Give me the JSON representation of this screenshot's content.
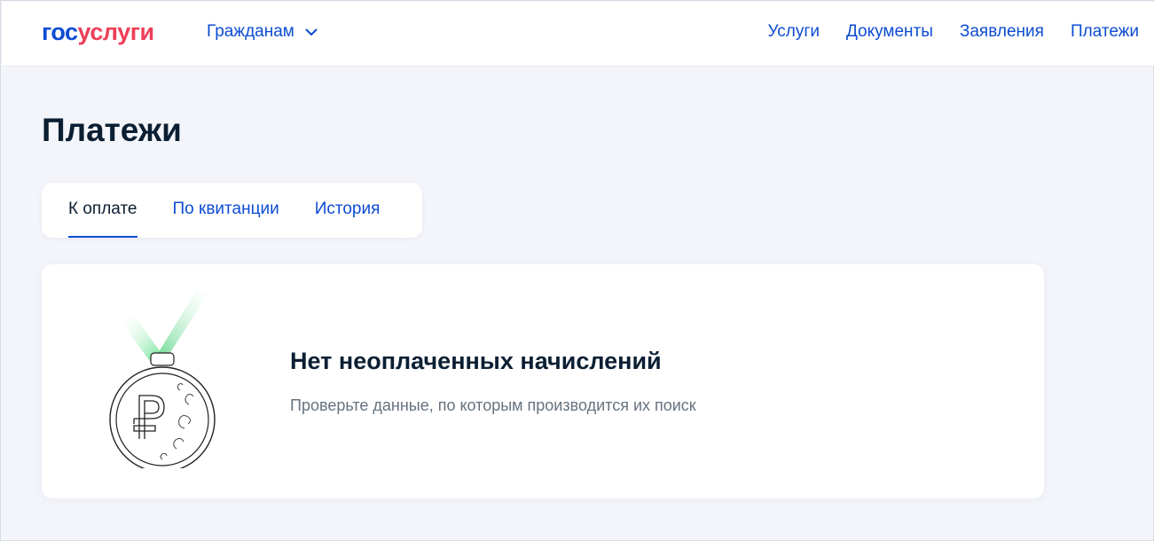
{
  "header": {
    "logo_part1": "гос",
    "logo_part2": "услуги",
    "audience_selector": "Гражданам",
    "nav": [
      "Услуги",
      "Документы",
      "Заявления",
      "Платежи"
    ]
  },
  "page": {
    "title": "Платежи"
  },
  "tabs": [
    "К оплате",
    "По квитанции",
    "История"
  ],
  "active_tab": "К оплате",
  "empty_state": {
    "title": "Нет неоплаченных начислений",
    "text": "Проверьте данные, по которым производится их поиск",
    "illustration": "ruble-medal-icon"
  },
  "colors": {
    "brand_blue": "#0d4cd3",
    "brand_red": "#ee3f58",
    "text_dark": "#0b1f33",
    "text_muted": "#66727f",
    "ribbon_green": "#5ee08a"
  }
}
